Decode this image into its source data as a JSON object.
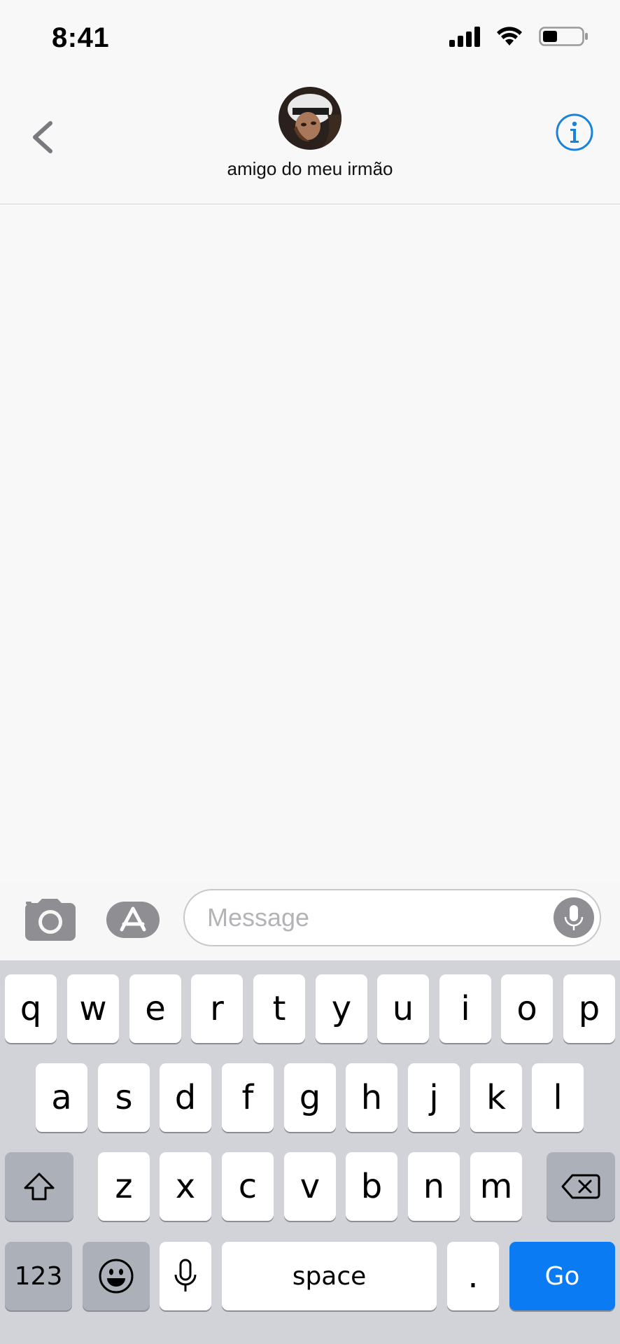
{
  "status_bar": {
    "time": "8:41",
    "icons": [
      "cellular-signal-icon",
      "wifi-icon",
      "battery-icon"
    ]
  },
  "header": {
    "contact_name": "amigo do meu irmão",
    "back_icon": "chevron-left-icon",
    "info_icon": "info-icon",
    "accent_color": "#1a82d9"
  },
  "composer": {
    "camera_icon": "camera-icon",
    "apps_icon": "app-store-icon",
    "message_placeholder": "Message",
    "message_value": "",
    "dictate_icon": "microphone-icon"
  },
  "keyboard": {
    "row1": [
      "q",
      "w",
      "e",
      "r",
      "t",
      "y",
      "u",
      "i",
      "o",
      "p"
    ],
    "row2": [
      "a",
      "s",
      "d",
      "f",
      "g",
      "h",
      "j",
      "k",
      "l"
    ],
    "row3": [
      "z",
      "x",
      "c",
      "v",
      "b",
      "n",
      "m"
    ],
    "numbers_label": "123",
    "space_label": "space",
    "period_label": ".",
    "go_label": "Go",
    "go_color": "#0b7bf3"
  }
}
